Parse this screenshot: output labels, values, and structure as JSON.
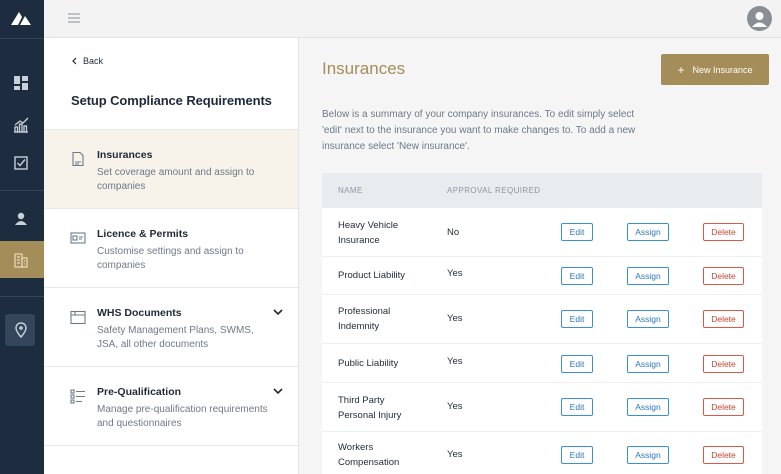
{
  "colors": {
    "rail_bg": "#1d2c3e",
    "accent_gold": "#a48d58",
    "edit_blue": "#3b8fd3",
    "delete_red": "#d45a4a"
  },
  "rail": {
    "icons": [
      "logo-icon",
      "dashboard-icon",
      "chart-icon",
      "checkbox-icon",
      "user-icon",
      "building-icon",
      "map-pin-icon"
    ],
    "active": "building-icon"
  },
  "topbar": {
    "menu_icon": "hamburger-icon",
    "avatar_icon": "user-avatar-icon"
  },
  "panel": {
    "back_label": "Back",
    "title": "Setup Compliance Requirements",
    "items": [
      {
        "title": "Insurances",
        "desc": "Set coverage amount and assign to companies",
        "icon": "document-icon",
        "active": true,
        "expandable": false
      },
      {
        "title": "Licence & Permits",
        "desc": "Customise settings and assign to companies",
        "icon": "id-card-icon",
        "active": false,
        "expandable": false
      },
      {
        "title": "WHS Documents",
        "desc": "Safety Management Plans, SWMS, JSA, all other documents",
        "icon": "folder-icon",
        "active": false,
        "expandable": true
      },
      {
        "title": "Pre-Qualification",
        "desc": "Manage pre-qualification requirements and questionnaires",
        "icon": "checklist-icon",
        "active": false,
        "expandable": true
      }
    ]
  },
  "main": {
    "title": "Insurances",
    "new_button_label": "New Insurance",
    "intro": "Below is a summary of your company insurances. To edit simply select 'edit' next to the insurance you want to make changes to. To add a new insurance select 'New insurance'.",
    "table": {
      "headers": {
        "name": "NAME",
        "approval": "APPROVAL REQUIRED"
      },
      "rows": [
        {
          "name": "Heavy Vehicle Insurance",
          "approval": "No"
        },
        {
          "name": "Product Liability",
          "approval": "Yes"
        },
        {
          "name": "Professional Indemnity",
          "approval": "Yes"
        },
        {
          "name": "Public Liability",
          "approval": "Yes"
        },
        {
          "name": "Third Party Personal Injury",
          "approval": "Yes"
        },
        {
          "name": "Workers Compensation",
          "approval": "Yes"
        }
      ],
      "actions": {
        "edit": "Edit",
        "assign": "Assign",
        "delete": "Delete"
      }
    }
  }
}
